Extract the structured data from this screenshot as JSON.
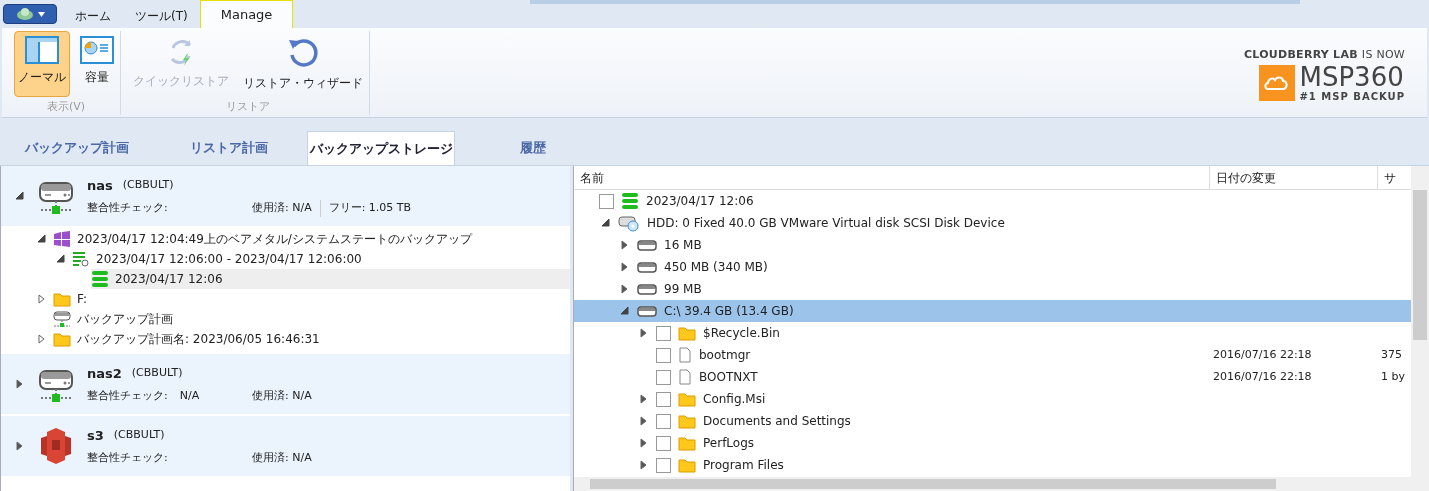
{
  "ribbon_tabs": [
    {
      "label": "ホーム",
      "selected": false
    },
    {
      "label": "ツール(T)",
      "selected": false
    },
    {
      "label": "Manage",
      "selected": true
    }
  ],
  "ribbon_groups": [
    {
      "label": "表示(V)",
      "buttons": [
        {
          "label": "ノーマル",
          "selected": true,
          "disabled": false
        },
        {
          "label": "容量",
          "selected": false,
          "disabled": false
        }
      ]
    },
    {
      "label": "リストア",
      "buttons": [
        {
          "label": "クイックリストア",
          "selected": false,
          "disabled": true
        },
        {
          "label": "リストア・ウィザード",
          "selected": false,
          "disabled": false
        }
      ]
    }
  ],
  "logo": {
    "brand": "CLOUDBERRY LAB",
    "note": "IS NOW",
    "name": "MSP360",
    "tagline": "#1 MSP BACKUP"
  },
  "main_tabs": [
    {
      "label": "バックアップ計画",
      "selected": false
    },
    {
      "label": "リストア計画",
      "selected": false
    },
    {
      "label": "バックアップストレージ",
      "selected": true
    },
    {
      "label": "履歴",
      "selected": false
    }
  ],
  "storage_accounts": [
    {
      "kind": "nas",
      "name": "nas",
      "account": "(CBBULT)",
      "expanded": true,
      "integrity": "整合性チェック:",
      "used": "使用済: N/A",
      "free": "フリー: 1.05 TB",
      "children": [
        {
          "kind": "windows",
          "label": "2023/04/17 12:04:49上のベアメタル/システムステートのバックアップ",
          "expanded": true,
          "selected": false,
          "children": [
            {
              "kind": "chain",
              "label": "2023/04/17 12:06:00 - 2023/04/17 12:06:00",
              "expanded": true,
              "selected": false,
              "children": [
                {
                  "kind": "restore-point",
                  "label": "2023/04/17 12:06",
                  "selected": true
                }
              ]
            }
          ]
        },
        {
          "kind": "folder",
          "label": "F:",
          "expanded": false,
          "selected": false
        },
        {
          "kind": "plan",
          "label": "バックアップ計画",
          "selected": false
        },
        {
          "kind": "folder",
          "label": "バックアップ計画名: 2023/06/05 16:46:31",
          "expanded": false,
          "selected": false
        }
      ]
    },
    {
      "kind": "nas",
      "name": "nas2",
      "account": "(CBBULT)",
      "expanded": false,
      "integrity": "整合性チェック:",
      "integrity_value": "N/A",
      "used": "使用済: N/A"
    },
    {
      "kind": "s3",
      "name": "s3",
      "account": "(CBBULT)",
      "expanded": false,
      "integrity": "整合性チェック:",
      "used": "使用済: N/A"
    }
  ],
  "file_table": {
    "columns": [
      "名前",
      "日付の変更",
      "サ"
    ],
    "rows": [
      {
        "kind": "restore-point",
        "name": "2023/04/17 12:06",
        "checked": false,
        "selected": false,
        "children": [
          {
            "kind": "hdd",
            "name": "HDD: 0 Fixed 40.0 GB VMware Virtual disk SCSI Disk Device",
            "expanded": true,
            "selected": false,
            "children": [
              {
                "kind": "partition",
                "name": "16 MB",
                "expanded": false,
                "selected": false
              },
              {
                "kind": "partition",
                "name": "450 MB (340 MB)",
                "expanded": false,
                "selected": false
              },
              {
                "kind": "partition",
                "name": "99 MB",
                "expanded": false,
                "selected": false
              },
              {
                "kind": "partition",
                "name": "C:\\ 39.4 GB (13.4 GB)",
                "expanded": true,
                "selected": true,
                "children": [
                  {
                    "kind": "folder",
                    "name": "$Recycle.Bin",
                    "expanded": false,
                    "checked": false,
                    "selected": false
                  },
                  {
                    "kind": "file",
                    "name": "bootmgr",
                    "checked": false,
                    "selected": false,
                    "date": "2016/07/16 22:18",
                    "size": "375"
                  },
                  {
                    "kind": "file",
                    "name": "BOOTNXT",
                    "checked": false,
                    "selected": false,
                    "date": "2016/07/16 22:18",
                    "size": "1 by"
                  },
                  {
                    "kind": "folder",
                    "name": "Config.Msi",
                    "expanded": false,
                    "checked": false,
                    "selected": false
                  },
                  {
                    "kind": "folder",
                    "name": "Documents and Settings",
                    "expanded": false,
                    "checked": false,
                    "selected": false
                  },
                  {
                    "kind": "folder",
                    "name": "PerfLogs",
                    "expanded": false,
                    "checked": false,
                    "selected": false
                  },
                  {
                    "kind": "folder",
                    "name": "Program Files",
                    "expanded": false,
                    "checked": false,
                    "selected": false
                  }
                ]
              }
            ]
          }
        ]
      }
    ]
  }
}
